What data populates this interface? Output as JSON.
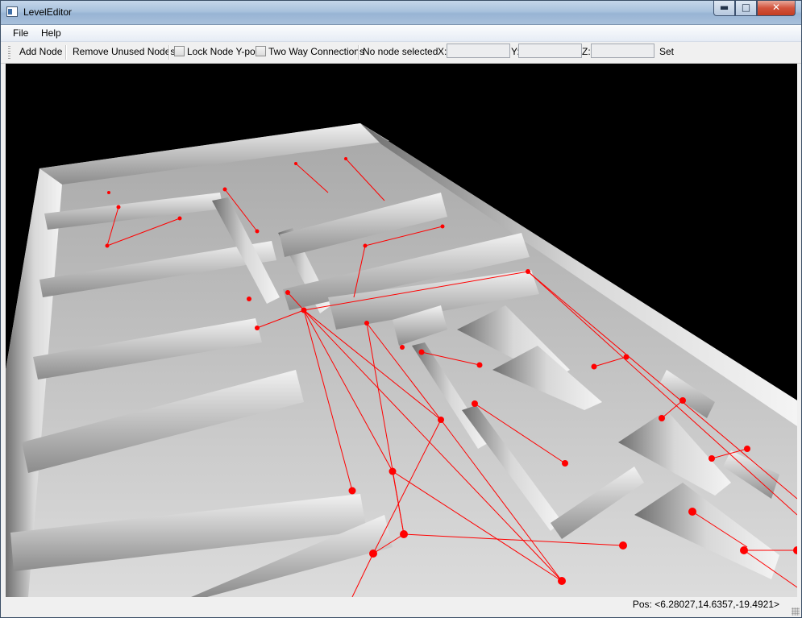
{
  "window": {
    "title": "LevelEditor",
    "min_glyph": "▬",
    "max_glyph": "□",
    "close_glyph": "✕"
  },
  "menu": {
    "file": "File",
    "help": "Help"
  },
  "toolbar": {
    "add_node": "Add Node",
    "remove_unused": "Remove Unused Nodes",
    "lock_y": "Lock Node Y-pos",
    "lock_y_checked": false,
    "two_way": "Two Way Connections",
    "two_way_checked": false,
    "selection_status": "No node selected",
    "x_label": "X:",
    "y_label": "Y:",
    "z_label": "Z:",
    "x_value": "",
    "y_value": "",
    "z_value": "",
    "set": "Set"
  },
  "viewport": {
    "description_icon": "3d-level-viewport",
    "node_color": "#ff0000",
    "background": "#000000"
  },
  "status": {
    "pos": "Pos: <6.28027,14.6357,-19.4921>"
  }
}
